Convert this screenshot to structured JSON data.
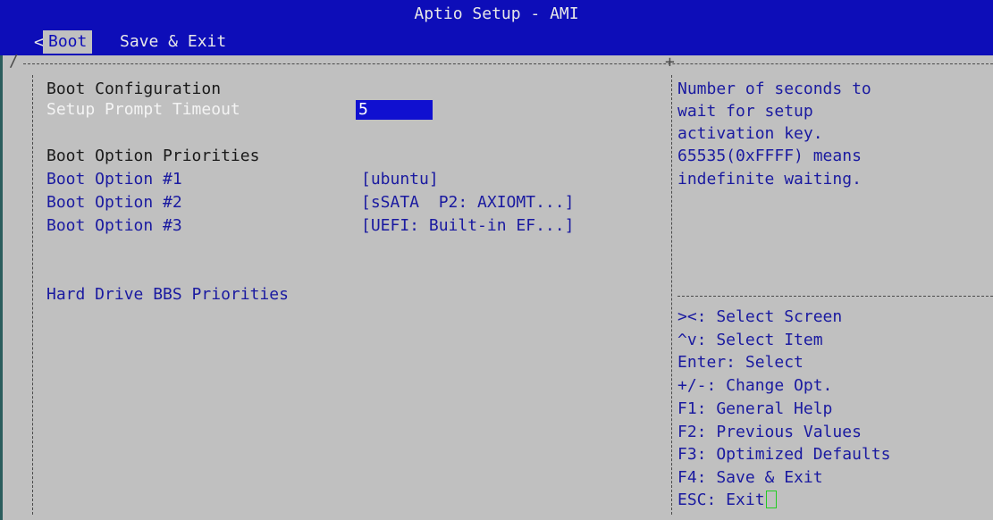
{
  "header": {
    "title": "Aptio Setup - AMI",
    "tab_prev_glyph": "<",
    "tabs": [
      {
        "label": "Boot",
        "active": true
      },
      {
        "label": "Save & Exit",
        "active": false
      }
    ]
  },
  "main": {
    "section_title": "Boot Configuration",
    "setup_prompt_timeout": {
      "label": "Setup Prompt Timeout",
      "value": "5"
    },
    "priorities_title": "Boot Option Priorities",
    "boot_options": [
      {
        "label": "Boot Option #1",
        "value": "[ubuntu]"
      },
      {
        "label": "Boot Option #2",
        "value": "[sSATA  P2: AXIOMT...]"
      },
      {
        "label": "Boot Option #3",
        "value": "[UEFI: Built-in EF...]"
      }
    ],
    "hdd_bbs": "Hard Drive BBS Priorities"
  },
  "help": {
    "description_lines": [
      "Number of seconds to",
      "wait for setup",
      "activation key.",
      "65535(0xFFFF) means",
      "indefinite waiting."
    ],
    "keys": [
      "><: Select Screen",
      "^v: Select Item",
      "Enter: Select",
      "+/-: Change Opt.",
      "F1: General Help",
      "F2: Previous Values",
      "F3: Optimized Defaults",
      "F4: Save & Exit",
      "ESC: Exit"
    ]
  },
  "colors": {
    "header_bg": "#0d0db8",
    "screen_bg": "#c0c0c0",
    "item_text": "#1a1aa0",
    "highlight_bg": "#1010d0"
  }
}
